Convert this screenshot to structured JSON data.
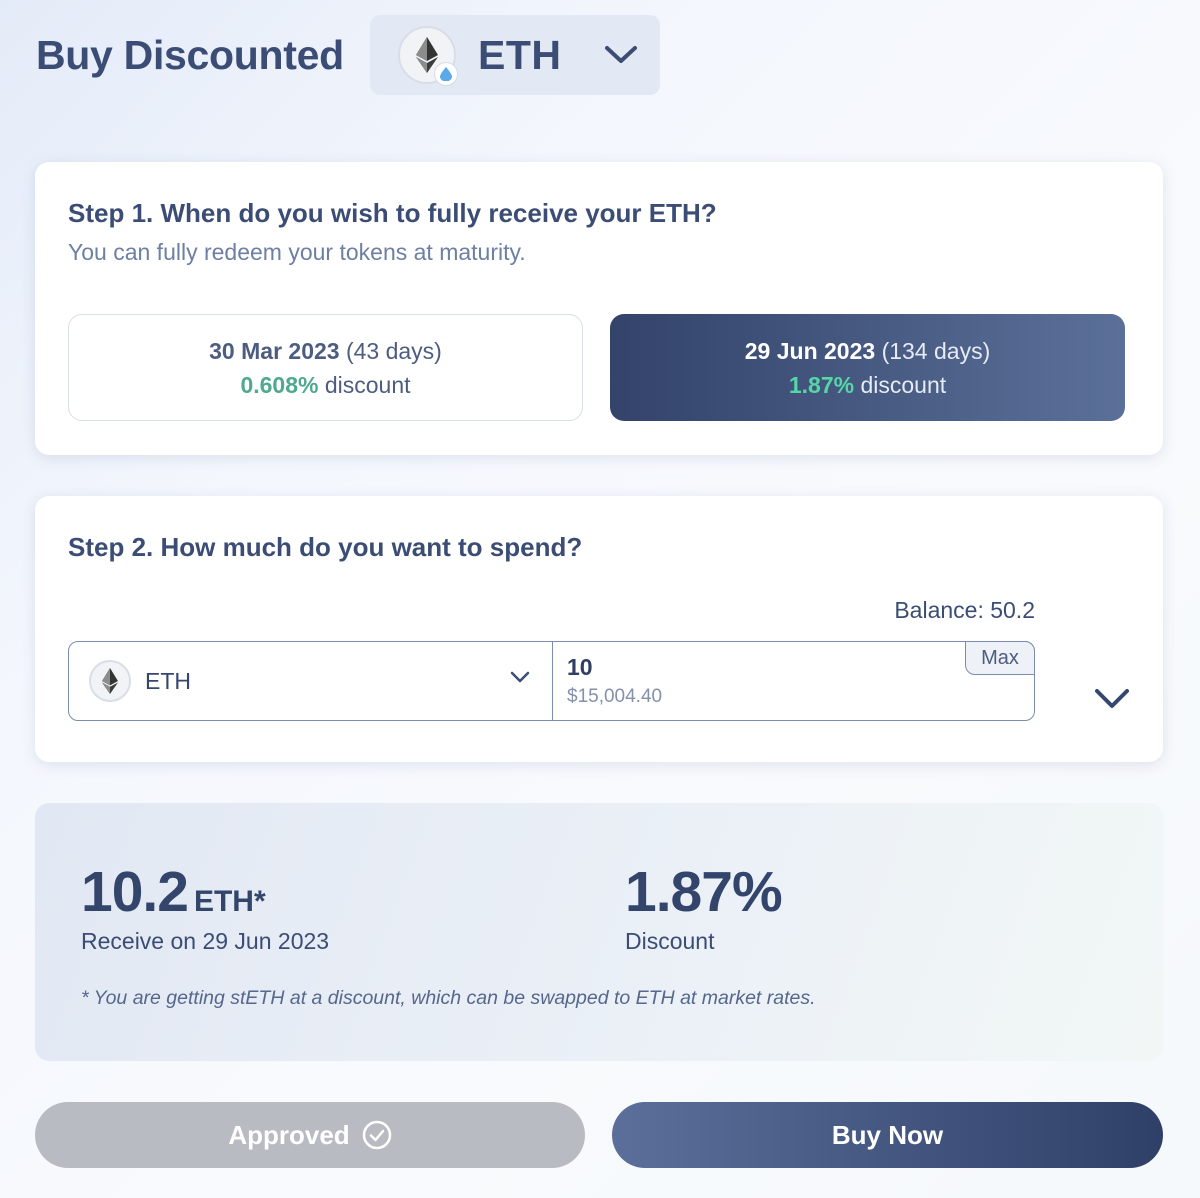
{
  "header": {
    "title": "Buy Discounted",
    "asset": "ETH",
    "asset_icon": "eth-icon"
  },
  "step1": {
    "title": "Step 1. When do you wish to fully receive your ETH?",
    "subtitle": "You can fully redeem your tokens at maturity.",
    "options": [
      {
        "date": "30 Mar 2023",
        "days": "(43 days)",
        "discount": "0.608%",
        "discount_label": "discount",
        "selected": false
      },
      {
        "date": "29 Jun 2023",
        "days": "(134 days)",
        "discount": "1.87%",
        "discount_label": "discount",
        "selected": true
      }
    ]
  },
  "step2": {
    "title": "Step 2. How much do you want to spend?",
    "balance": "Balance: 50.2",
    "token": "ETH",
    "amount": "10",
    "usd_value": "$15,004.40",
    "max_label": "Max"
  },
  "summary": {
    "receive_amount": "10.2",
    "receive_unit": "ETH*",
    "receive_label": "Receive on 29 Jun 2023",
    "discount_value": "1.87%",
    "discount_label": "Discount",
    "footnote": "* You are getting stETH at a discount, which can be swapped to ETH at market rates."
  },
  "actions": {
    "approved_label": "Approved",
    "buy_label": "Buy Now"
  },
  "colors": {
    "primary_dark": "#33436a",
    "accent_green": "#55d6a8",
    "text": "#3b4d74",
    "disabled": "#b8bbc1"
  }
}
